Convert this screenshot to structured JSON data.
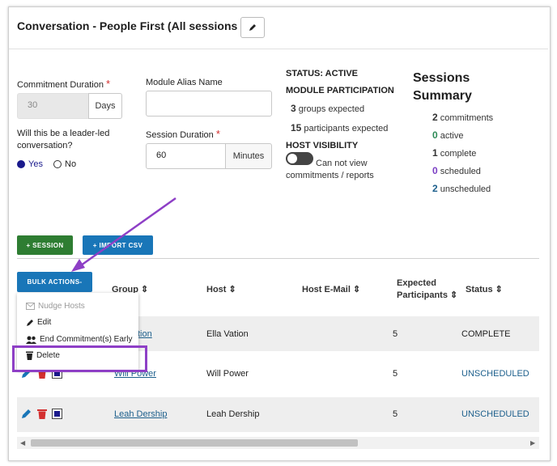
{
  "header": {
    "title": "Conversation - People First (All sessions )"
  },
  "form": {
    "commitment_label": "Commitment Duration",
    "required_mark": "*",
    "commitment_value": "30",
    "commitment_unit": "Days",
    "alias_label": "Module Alias Name",
    "alias_value": "",
    "leader_question": "Will this be a leader-led conversation?",
    "yes_label": "Yes",
    "no_label": "No",
    "session_duration_label": "Session Duration",
    "session_duration_value": "60",
    "session_duration_unit": "Minutes"
  },
  "status": {
    "status_heading": "STATUS: ACTIVE",
    "participation_heading": "MODULE PARTICIPATION",
    "groups_count": "3",
    "groups_text": "groups expected",
    "participants_count": "15",
    "participants_text": "participants expected",
    "host_visibility_heading": "HOST VISIBILITY",
    "host_visibility_text": "Can not view commitments / reports"
  },
  "summary": {
    "title": "Sessions Summary",
    "items": [
      {
        "count": "2",
        "label": "commitments",
        "color": "#333333"
      },
      {
        "count": "0",
        "label": "active",
        "color": "#2e8b57"
      },
      {
        "count": "1",
        "label": "complete",
        "color": "#333333"
      },
      {
        "count": "0",
        "label": "scheduled",
        "color": "#7b3fc4"
      },
      {
        "count": "2",
        "label": "unscheduled",
        "color": "#1c5f8c"
      }
    ]
  },
  "buttons": {
    "session": "+ SESSION",
    "import": "+ IMPORT CSV",
    "bulk": "BULK ACTIONS-"
  },
  "table": {
    "headers": {
      "group": "Group",
      "host": "Host",
      "host_email": "Host E-Mail",
      "expected": "Expected Participants",
      "status": "Status"
    },
    "rows": [
      {
        "group": "Ella Vation",
        "host": "Ella Vation",
        "email": "",
        "expected": "5",
        "status": "COMPLETE"
      },
      {
        "group": "Will Power",
        "host": "Will Power",
        "email": "",
        "expected": "5",
        "status": "UNSCHEDULED"
      },
      {
        "group": "Leah Dership",
        "host": "Leah Dership",
        "email": "",
        "expected": "5",
        "status": "UNSCHEDULED"
      }
    ],
    "row0_partial_group": "tion"
  },
  "bulk_menu": {
    "items": [
      "Nudge Hosts",
      "Edit",
      "End Commitment(s) Early",
      "Delete"
    ]
  },
  "colors": {
    "green": "#2e7d32",
    "blue": "#1976b8",
    "highlight": "#8e3fc6"
  }
}
